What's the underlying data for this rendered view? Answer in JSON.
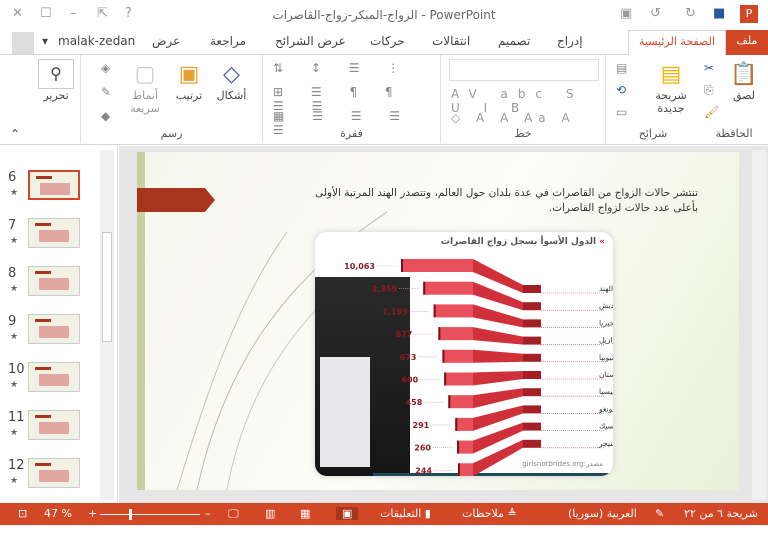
{
  "window": {
    "title": "الزواج-المبكر-زواج-القاصرات - PowerPoint",
    "user": "malak-zedan"
  },
  "tabs": [
    "ملف",
    "الصفحة الرئيسية",
    "إدراج",
    "تصميم",
    "انتقالات",
    "حركات",
    "عرض الشرائح",
    "مراجعة",
    "عرض"
  ],
  "ribbon": {
    "groups": [
      "الحافظة",
      "شرائح",
      "خط",
      "فقرة",
      "رسم"
    ],
    "paste": "لصق",
    "new_slide_1": "شريحة",
    "new_slide_2": "جديدة",
    "shapes": "أشكال",
    "arrange": "ترتيب",
    "styles_1": "أنماط",
    "styles_2": "سريعة",
    "edit": "تحرير"
  },
  "thumbnails": [
    {
      "n": "6",
      "selected": true
    },
    {
      "n": "7"
    },
    {
      "n": "8"
    },
    {
      "n": "9"
    },
    {
      "n": "10"
    },
    {
      "n": "11"
    },
    {
      "n": "12"
    }
  ],
  "slide": {
    "text": "تنتشر حالات الزواج من القاصرات في عدة بلدان حول العالم، وتتصدر الهند المرتبة الأولى بأعلى عدد حالات لزواج القاصرات."
  },
  "chart_data": {
    "type": "bar",
    "title": "الدول الأسوأ بسجل زواج القاصرات",
    "source": "girlsnotbrides.org:مصدر",
    "categories": [
      "الهند",
      "بنجلاديش",
      "نيجيريا",
      "البرازيل",
      "إثيوبيا",
      "باكستان",
      "إندونيسيا",
      "الكونغو",
      "المكسيك",
      "النيجر"
    ],
    "values": [
      10063,
      2359,
      1193,
      877,
      673,
      600,
      458,
      291,
      260,
      244
    ],
    "labels": [
      "10,063",
      "2,359",
      "1,193",
      "877",
      "673",
      "600",
      "458",
      "291",
      "260",
      "244"
    ]
  },
  "status": {
    "slide": "شريحة ٦ من ٢٢",
    "language": "العربية (سوريا)",
    "notes": "ملاحظات",
    "comments": "التعليقات",
    "zoom": "47 %",
    "zoom_value": 47
  },
  "colors": {
    "accent": "#d24726",
    "bar": "#e8505b",
    "bar_dark": "#a51f27"
  }
}
